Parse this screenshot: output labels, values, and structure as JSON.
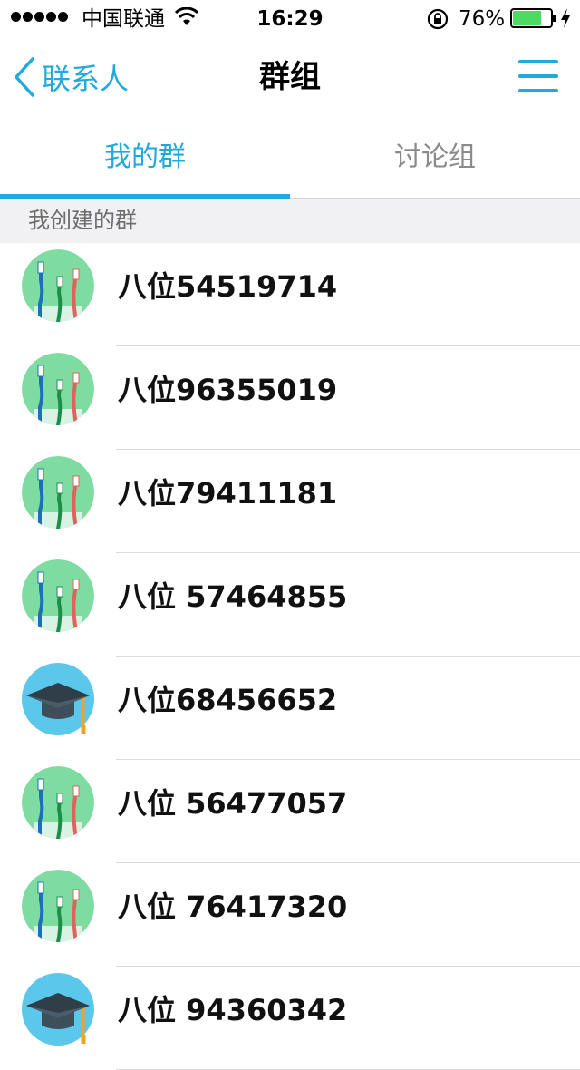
{
  "status_bar": {
    "carrier": "中国联通",
    "time": "16:29",
    "battery_percent": "76%",
    "battery_level": 0.76
  },
  "nav": {
    "back_label": "联系人",
    "title": "群组"
  },
  "tabs": [
    {
      "label": "我的群",
      "active": true
    },
    {
      "label": "讨论组",
      "active": false
    }
  ],
  "section": {
    "title": "我创建的群"
  },
  "groups": [
    {
      "name": "八位54519714",
      "avatar": "toothbrush-icon"
    },
    {
      "name": "八位96355019",
      "avatar": "toothbrush-icon"
    },
    {
      "name": "八位79411181",
      "avatar": "toothbrush-icon"
    },
    {
      "name": "八位 57464855",
      "avatar": "toothbrush-icon"
    },
    {
      "name": "八位68456652",
      "avatar": "graduation-cap-icon"
    },
    {
      "name": "八位 56477057",
      "avatar": "toothbrush-icon"
    },
    {
      "name": "八位 76417320",
      "avatar": "toothbrush-icon"
    },
    {
      "name": "八位 94360342",
      "avatar": "graduation-cap-icon"
    }
  ],
  "colors": {
    "accent": "#21a8dc",
    "toothbrush_bg": "#7fdca0",
    "cap_bg": "#5bc7ea"
  }
}
